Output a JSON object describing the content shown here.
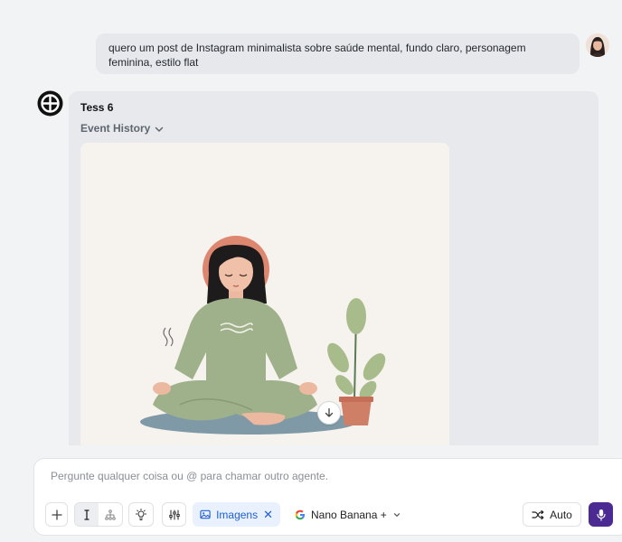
{
  "user_message": {
    "line1": "quero um post de Instagram minimalista sobre saúde mental, fundo claro, personagem",
    "line2": "feminina, estilo flat"
  },
  "bot": {
    "name": "Tess 6",
    "event_history_label": "Event History"
  },
  "composer": {
    "placeholder": "Pergunte qualquer coisa ou @ para chamar outro agente.",
    "value": "",
    "images_chip_label": "Imagens",
    "images_chip_close": "✕",
    "model_label": "Nano Banana +",
    "auto_label": "Auto"
  },
  "colors": {
    "accent_purple": "#4b2a91",
    "chip_blue": "#1f5fd6",
    "chip_bg": "#e9f1ff"
  },
  "icons": {
    "add": "plus-icon",
    "mode_text": "cursor-icon",
    "mode_tree": "hierarchy-icon",
    "idea": "lightbulb-icon",
    "settings": "sliders-icon",
    "images": "image-icon",
    "google": "google-icon",
    "shuffle": "shuffle-icon",
    "mic": "microphone-icon",
    "download": "download-arrow-icon"
  }
}
